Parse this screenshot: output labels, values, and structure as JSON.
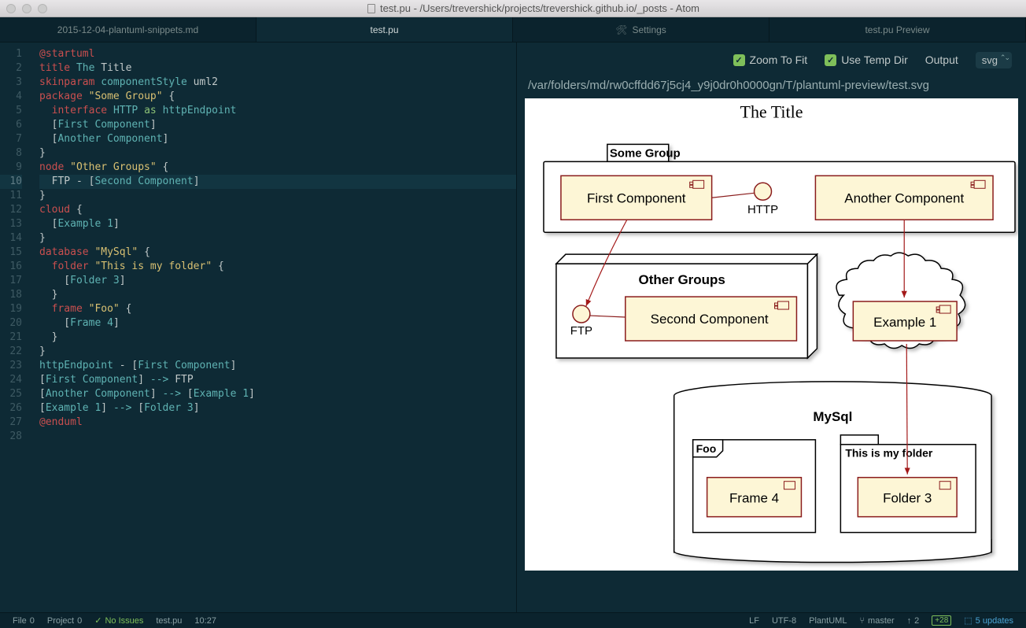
{
  "window": {
    "title": "test.pu - /Users/trevershick/projects/trevershick.github.io/_posts - Atom"
  },
  "tabs": [
    {
      "label": "2015-12-04-plantuml-snippets.md",
      "active": false,
      "icon": null
    },
    {
      "label": "test.pu",
      "active": true,
      "icon": null
    },
    {
      "label": "Settings",
      "active": false,
      "icon": "gear"
    },
    {
      "label": "test.pu Preview",
      "active": false,
      "icon": null
    }
  ],
  "editor": {
    "current_line": 10,
    "lines": [
      {
        "n": 1,
        "tokens": [
          [
            "kw",
            "@startuml"
          ]
        ]
      },
      {
        "n": 2,
        "tokens": [
          [
            "kw",
            "title "
          ],
          [
            "type",
            "The"
          ],
          [
            "plain",
            " Title"
          ]
        ]
      },
      {
        "n": 3,
        "tokens": [
          [
            "kw",
            "skinparam "
          ],
          [
            "type",
            "componentStyle"
          ],
          [
            "plain",
            " uml2"
          ]
        ]
      },
      {
        "n": 4,
        "tokens": [
          [
            "kw",
            "package "
          ],
          [
            "str",
            "\"Some Group\""
          ],
          [
            "plain",
            " {"
          ]
        ]
      },
      {
        "n": 5,
        "tokens": [
          [
            "plain",
            "  "
          ],
          [
            "kw",
            "interface "
          ],
          [
            "type",
            "HTTP "
          ],
          [
            "green",
            "as "
          ],
          [
            "type",
            "httpEndpoint"
          ]
        ]
      },
      {
        "n": 6,
        "tokens": [
          [
            "plain",
            "  ["
          ],
          [
            "type",
            "First Component"
          ],
          [
            "plain",
            "]"
          ]
        ]
      },
      {
        "n": 7,
        "tokens": [
          [
            "plain",
            "  ["
          ],
          [
            "type",
            "Another Component"
          ],
          [
            "plain",
            "]"
          ]
        ]
      },
      {
        "n": 8,
        "tokens": [
          [
            "plain",
            "}"
          ]
        ]
      },
      {
        "n": 9,
        "tokens": [
          [
            "kw",
            "node "
          ],
          [
            "str",
            "\"Other Groups\""
          ],
          [
            "plain",
            " {"
          ]
        ]
      },
      {
        "n": 10,
        "tokens": [
          [
            "plain",
            "  FTP - ["
          ],
          [
            "type",
            "Second Component"
          ],
          [
            "plain",
            "]"
          ]
        ]
      },
      {
        "n": 11,
        "tokens": [
          [
            "plain",
            "}"
          ]
        ]
      },
      {
        "n": 12,
        "tokens": [
          [
            "kw",
            "cloud"
          ],
          [
            "plain",
            " {"
          ]
        ]
      },
      {
        "n": 13,
        "tokens": [
          [
            "plain",
            "  ["
          ],
          [
            "type",
            "Example 1"
          ],
          [
            "plain",
            "]"
          ]
        ]
      },
      {
        "n": 14,
        "tokens": [
          [
            "plain",
            "}"
          ]
        ]
      },
      {
        "n": 15,
        "tokens": [
          [
            "kw",
            "database "
          ],
          [
            "str",
            "\"MySql\""
          ],
          [
            "plain",
            " {"
          ]
        ]
      },
      {
        "n": 16,
        "tokens": [
          [
            "plain",
            "  "
          ],
          [
            "kw",
            "folder "
          ],
          [
            "str",
            "\"This is my folder\""
          ],
          [
            "plain",
            " {"
          ]
        ]
      },
      {
        "n": 17,
        "tokens": [
          [
            "plain",
            "    ["
          ],
          [
            "type",
            "Folder 3"
          ],
          [
            "plain",
            "]"
          ]
        ]
      },
      {
        "n": 18,
        "tokens": [
          [
            "plain",
            "  }"
          ]
        ]
      },
      {
        "n": 19,
        "tokens": [
          [
            "plain",
            "  "
          ],
          [
            "kw",
            "frame "
          ],
          [
            "str",
            "\"Foo\""
          ],
          [
            "plain",
            " {"
          ]
        ]
      },
      {
        "n": 20,
        "tokens": [
          [
            "plain",
            "    ["
          ],
          [
            "type",
            "Frame 4"
          ],
          [
            "plain",
            "]"
          ]
        ]
      },
      {
        "n": 21,
        "tokens": [
          [
            "plain",
            "  }"
          ]
        ]
      },
      {
        "n": 22,
        "tokens": [
          [
            "plain",
            "}"
          ]
        ]
      },
      {
        "n": 23,
        "tokens": [
          [
            "type",
            "httpEndpoint"
          ],
          [
            "plain",
            " - ["
          ],
          [
            "type",
            "First Component"
          ],
          [
            "plain",
            "]"
          ]
        ]
      },
      {
        "n": 24,
        "tokens": [
          [
            "plain",
            "["
          ],
          [
            "type",
            "First Component"
          ],
          [
            "plain",
            "] "
          ],
          [
            "op",
            "-->"
          ],
          [
            "plain",
            " FTP"
          ]
        ]
      },
      {
        "n": 25,
        "tokens": [
          [
            "plain",
            "["
          ],
          [
            "type",
            "Another Component"
          ],
          [
            "plain",
            "] "
          ],
          [
            "op",
            "-->"
          ],
          [
            "plain",
            " ["
          ],
          [
            "type",
            "Example 1"
          ],
          [
            "plain",
            "]"
          ]
        ]
      },
      {
        "n": 26,
        "tokens": [
          [
            "plain",
            "["
          ],
          [
            "type",
            "Example 1"
          ],
          [
            "plain",
            "] "
          ],
          [
            "op",
            "-->"
          ],
          [
            "plain",
            " ["
          ],
          [
            "type",
            "Folder 3"
          ],
          [
            "plain",
            "]"
          ]
        ]
      },
      {
        "n": 27,
        "tokens": [
          [
            "kw",
            "@enduml"
          ]
        ]
      },
      {
        "n": 28,
        "tokens": [
          [
            "plain",
            ""
          ]
        ]
      }
    ]
  },
  "preview": {
    "zoom_label": "Zoom To Fit",
    "tempdir_label": "Use Temp Dir",
    "output_label": "Output",
    "output_value": "svg",
    "path": "/var/folders/md/rw0cffdd67j5cj4_y9j0dr0h0000gn/T/plantuml-preview/test.svg",
    "diagram": {
      "title": "The Title",
      "nodes": {
        "group1": "Some Group",
        "first": "First Component",
        "http": "HTTP",
        "another": "Another Component",
        "group2": "Other Groups",
        "ftp": "FTP",
        "second": "Second Component",
        "example": "Example 1",
        "db": "MySql",
        "foo": "Foo",
        "frame4": "Frame 4",
        "folder": "This is my folder",
        "folder3": "Folder 3"
      }
    }
  },
  "status": {
    "file_btn": "File",
    "file_count": "0",
    "project_btn": "Project",
    "project_count": "0",
    "issues": "No Issues",
    "filename": "test.pu",
    "cursor": "10:27",
    "eol": "LF",
    "encoding": "UTF-8",
    "grammar": "PlantUML",
    "branch": "master",
    "ahead": "2",
    "diff": "+28",
    "updates": "5 updates"
  }
}
